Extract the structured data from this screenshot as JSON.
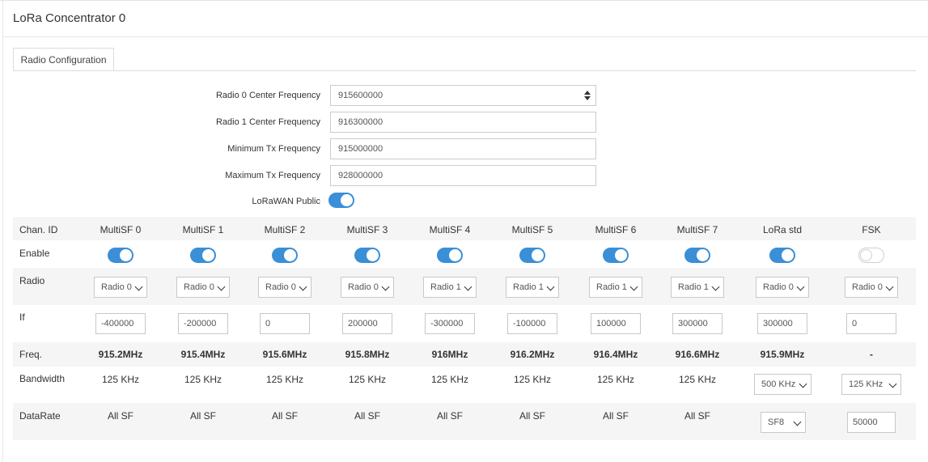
{
  "panel": {
    "title": "LoRa Concentrator 0"
  },
  "tabs": [
    {
      "label": "Radio Configuration"
    }
  ],
  "form": {
    "radio0_center": {
      "label": "Radio 0 Center Frequency",
      "value": "915600000"
    },
    "radio1_center": {
      "label": "Radio 1 Center Frequency",
      "value": "916300000"
    },
    "min_tx": {
      "label": "Minimum Tx Frequency",
      "value": "915000000"
    },
    "max_tx": {
      "label": "Maximum Tx Frequency",
      "value": "928000000"
    },
    "lorawan_public": {
      "label": "LoRaWAN Public",
      "enabled": true
    }
  },
  "table": {
    "row_labels": {
      "chan_id": "Chan. ID",
      "enable": "Enable",
      "radio": "Radio",
      "if": "If",
      "freq": "Freq.",
      "bandwidth": "Bandwidth",
      "datarate": "DataRate"
    },
    "channels": [
      {
        "name": "MultiSF 0",
        "enabled": true,
        "radio": "Radio 0",
        "if": "-400000",
        "freq": "915.2MHz",
        "bandwidth": "125 KHz",
        "datarate": "All SF"
      },
      {
        "name": "MultiSF 1",
        "enabled": true,
        "radio": "Radio 0",
        "if": "-200000",
        "freq": "915.4MHz",
        "bandwidth": "125 KHz",
        "datarate": "All SF"
      },
      {
        "name": "MultiSF 2",
        "enabled": true,
        "radio": "Radio 0",
        "if": "0",
        "freq": "915.6MHz",
        "bandwidth": "125 KHz",
        "datarate": "All SF"
      },
      {
        "name": "MultiSF 3",
        "enabled": true,
        "radio": "Radio 0",
        "if": "200000",
        "freq": "915.8MHz",
        "bandwidth": "125 KHz",
        "datarate": "All SF"
      },
      {
        "name": "MultiSF 4",
        "enabled": true,
        "radio": "Radio 1",
        "if": "-300000",
        "freq": "916MHz",
        "bandwidth": "125 KHz",
        "datarate": "All SF"
      },
      {
        "name": "MultiSF 5",
        "enabled": true,
        "radio": "Radio 1",
        "if": "-100000",
        "freq": "916.2MHz",
        "bandwidth": "125 KHz",
        "datarate": "All SF"
      },
      {
        "name": "MultiSF 6",
        "enabled": true,
        "radio": "Radio 1",
        "if": "100000",
        "freq": "916.4MHz",
        "bandwidth": "125 KHz",
        "datarate": "All SF"
      },
      {
        "name": "MultiSF 7",
        "enabled": true,
        "radio": "Radio 1",
        "if": "300000",
        "freq": "916.6MHz",
        "bandwidth": "125 KHz",
        "datarate": "All SF"
      },
      {
        "name": "LoRa std",
        "enabled": true,
        "radio": "Radio 0",
        "if": "300000",
        "freq": "915.9MHz",
        "bandwidth": "500 KHz",
        "datarate": "SF8"
      },
      {
        "name": "FSK",
        "enabled": false,
        "radio": "Radio 0",
        "if": "0",
        "freq": "-",
        "bandwidth": "125 KHz",
        "datarate": "50000"
      }
    ]
  },
  "colors": {
    "accent": "#3a8fd6",
    "row_stripe": "#f5f5f5"
  }
}
